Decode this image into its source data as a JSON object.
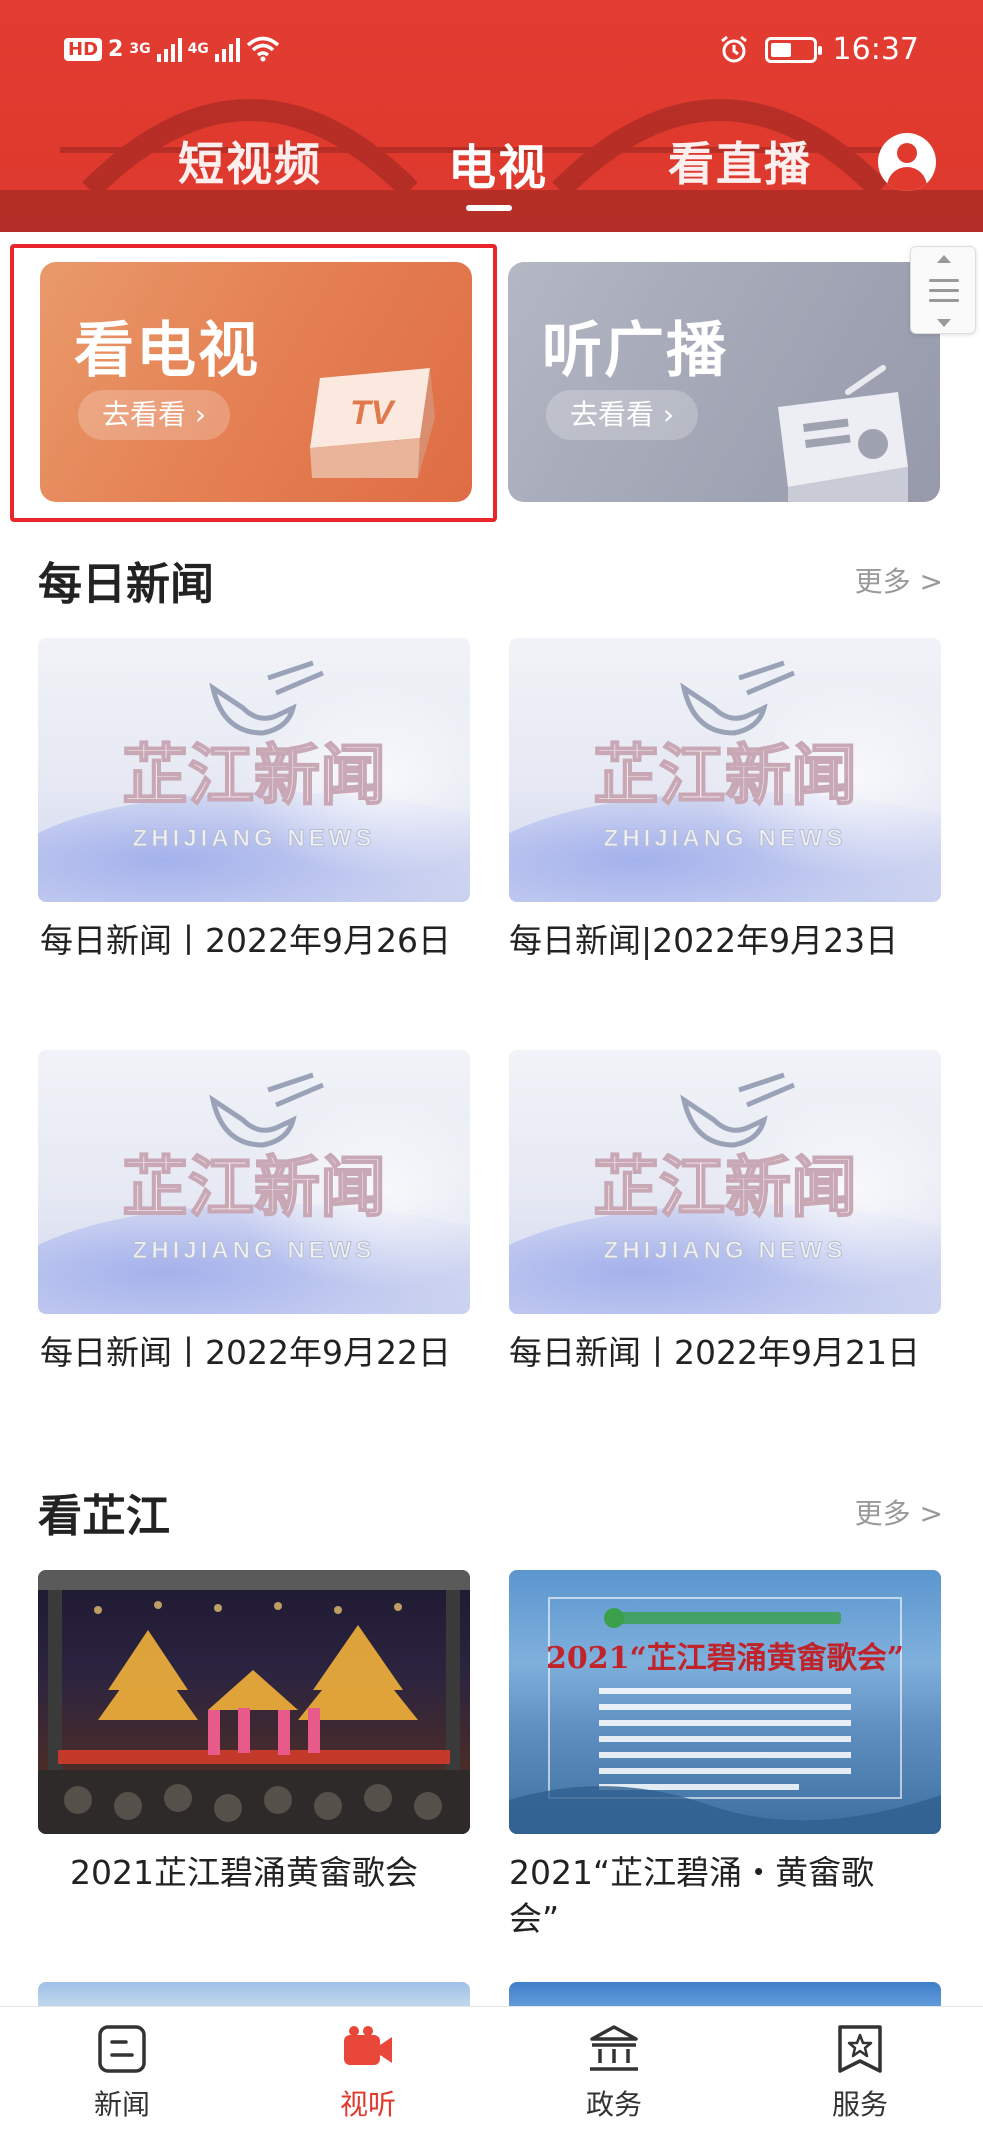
{
  "status_bar": {
    "hd": "HD",
    "sim": "2",
    "net1": "3G",
    "net2": "4G",
    "time": "16:37"
  },
  "header": {
    "tabs": [
      {
        "label": "短视频",
        "active": false
      },
      {
        "label": "电视",
        "active": true
      },
      {
        "label": "看直播",
        "active": false
      }
    ],
    "accent_color": "#e0392e"
  },
  "features": [
    {
      "title": "看电视",
      "button": "去看看 ›",
      "badge": "TV",
      "icon": "tv-icon"
    },
    {
      "title": "听广播",
      "button": "去看看 ›",
      "icon": "radio-icon"
    }
  ],
  "daily_news": {
    "title": "每日新闻",
    "more": "更多 >",
    "thumb_logo_cn": "芷江新闻",
    "thumb_logo_en": "ZHIJIANG NEWS",
    "items": [
      {
        "caption": "每日新闻丨2022年9月26日"
      },
      {
        "caption": "每日新闻|2022年9月23日"
      },
      {
        "caption": "每日新闻丨2022年9月22日"
      },
      {
        "caption": "每日新闻丨2022年9月21日"
      }
    ]
  },
  "zhijiang": {
    "title": "看芷江",
    "more": "更多 >",
    "items": [
      {
        "caption": "2021芷江碧涌黄畲歌会"
      },
      {
        "caption": "2021“芷江碧涌・黄畲歌会”",
        "poster_title": "2021“芷江碧涌黄畲歌会”"
      }
    ]
  },
  "bottom_nav": [
    {
      "label": "新闻",
      "icon": "news-icon",
      "active": false
    },
    {
      "label": "视听",
      "icon": "video-camera-icon",
      "active": true
    },
    {
      "label": "政务",
      "icon": "government-building-icon",
      "active": false
    },
    {
      "label": "服务",
      "icon": "service-star-icon",
      "active": false
    }
  ]
}
